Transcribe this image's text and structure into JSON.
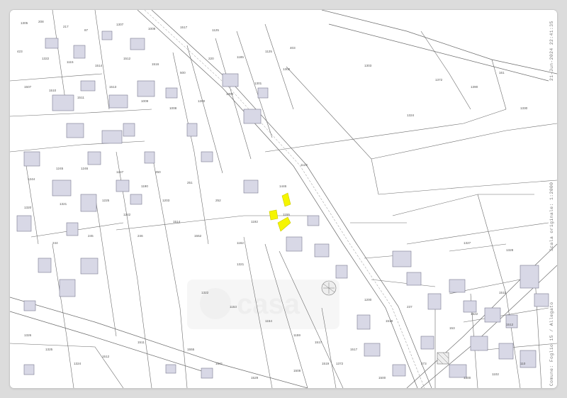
{
  "map": {
    "scale_text": "Scala originale: 1:2000",
    "date_text": "21-Jun-2024 22:41:35",
    "sheet_text": "Comune: Foglio 15 / Allegato",
    "watermark_text": "casa",
    "highlight_color": "#f5f500",
    "parcel_numbers": [
      "1305",
      "208",
      "217",
      "87",
      "1307",
      "1008",
      "1517",
      "1125",
      "423",
      "1322",
      "1115",
      "1514",
      "1512",
      "1516",
      "500",
      "220",
      "1185",
      "1125",
      "403",
      "1507",
      "1510",
      "1511",
      "1513",
      "1009",
      "1008",
      "1200",
      "1300",
      "1301",
      "1302",
      "1303",
      "1324",
      "1372",
      "1390",
      "161",
      "1330",
      "1122",
      "1446",
      "1155",
      "1192",
      "1162",
      "250",
      "251",
      "252",
      "1514",
      "1552",
      "246",
      "245",
      "244",
      "1320",
      "1321",
      "1225",
      "1242",
      "1244",
      "1245",
      "1246",
      "1247",
      "1190",
      "1203",
      "1321",
      "1322",
      "1153",
      "1154",
      "1159",
      "1517",
      "1372",
      "1200",
      "1519",
      "237",
      "273",
      "153",
      "1522",
      "1511",
      "1512",
      "110",
      "1300",
      "1102",
      "1500",
      "1517",
      "1519",
      "1508",
      "1529",
      "1541",
      "1555",
      "1511",
      "1512",
      "1324",
      "1325",
      "1326",
      "1327",
      "1328"
    ]
  }
}
